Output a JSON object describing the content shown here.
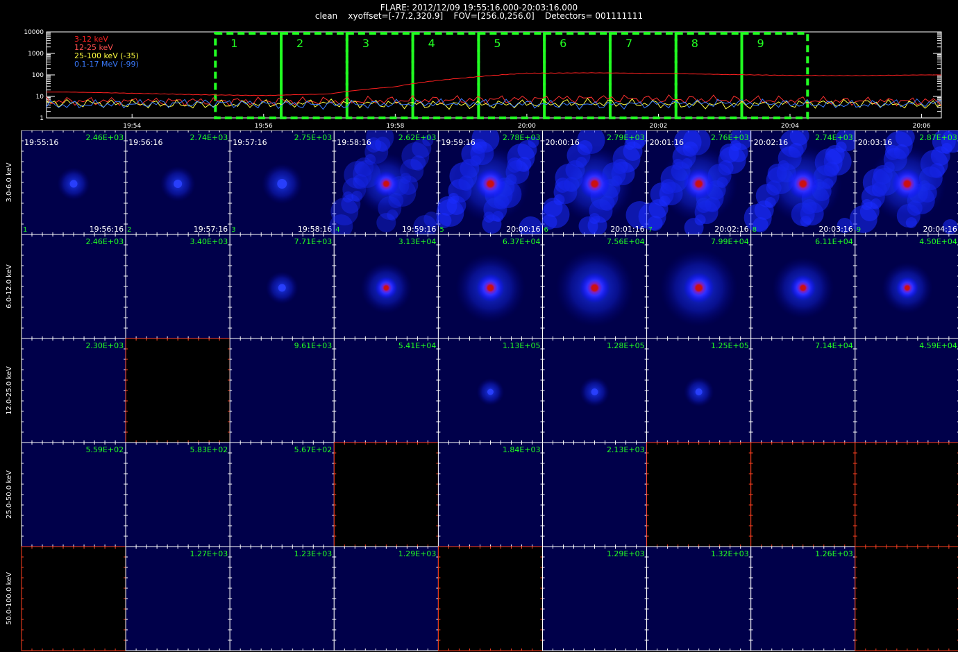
{
  "header": {
    "title": "FLARE: 2012/12/09 19:55:16.000-20:03:16.000",
    "subtitle": "clean    xyoffset=[-77.2,320.9]    FOV=[256.0,256.0]    Detectors= 001111111"
  },
  "chart_data": [
    {
      "type": "line",
      "name": "lightcurve",
      "yscale": "log",
      "ylim": [
        1,
        10000
      ],
      "y_ticks": [
        "10000",
        "1000",
        "100",
        "10",
        "1"
      ],
      "xlim_minutes": [
        19.6,
        20.12
      ],
      "x_ticks": [
        "19:54",
        "19:56",
        "19:58",
        "20:00",
        "20:02",
        "20:04",
        "20:06"
      ],
      "legend": [
        {
          "label": "3-12 keV",
          "color": "#ff2020"
        },
        {
          "label": "12-25 keV",
          "color": "#ff5050"
        },
        {
          "label": "25-100 keV (-35)",
          "color": "#ffff40"
        },
        {
          "label": "0.1-17 MeV (-99)",
          "color": "#3a7bff"
        }
      ],
      "series": [
        {
          "name": "12-25 keV",
          "color": "#ff2020",
          "x": [
            "19:53",
            "19:54",
            "19:55",
            "19:56",
            "19:57",
            "19:58",
            "19:59",
            "20:00",
            "20:01",
            "20:02",
            "20:03",
            "20:04",
            "20:05",
            "20:06"
          ],
          "values": [
            16,
            14,
            12,
            11,
            13,
            28,
            70,
            120,
            125,
            118,
            105,
            95,
            92,
            100
          ]
        },
        {
          "name": "3-12 keV",
          "color": "#ff3030",
          "x": [
            "19:53",
            "19:55",
            "19:57",
            "19:59",
            "20:01",
            "20:03",
            "20:05",
            "20:06"
          ],
          "values": [
            6,
            6,
            6,
            7,
            8,
            7,
            6,
            6
          ]
        },
        {
          "name": "25-100 keV (-35)",
          "color": "#ffff40",
          "x": [
            "19:53",
            "19:55",
            "19:57",
            "19:59",
            "20:01",
            "20:03",
            "20:05",
            "20:06"
          ],
          "values": [
            5,
            4,
            5,
            4,
            5,
            4,
            5,
            4
          ]
        },
        {
          "name": "0.1-17 MeV (-99)",
          "color": "#3a7bff",
          "x": [
            "19:53",
            "19:55",
            "19:57",
            "19:59",
            "20:01",
            "20:03",
            "20:05",
            "20:06"
          ],
          "values": [
            4,
            5,
            4,
            5,
            4,
            5,
            4,
            5
          ]
        }
      ],
      "intervals": [
        "1",
        "2",
        "3",
        "4",
        "5",
        "6",
        "7",
        "8",
        "9"
      ]
    },
    {
      "type": "heatmap",
      "name": "image-grid",
      "columns": 9,
      "start_times": [
        "19:55:16",
        "19:56:16",
        "19:57:16",
        "19:58:16",
        "19:59:16",
        "20:00:16",
        "20:01:16",
        "20:02:16",
        "20:03:16"
      ],
      "end_times": [
        "19:56:16",
        "19:57:16",
        "19:58:16",
        "19:59:16",
        "20:00:16",
        "20:01:16",
        "20:02:16",
        "20:03:16",
        "20:04:16"
      ],
      "rows": [
        {
          "label": "3.0-6.0 keV",
          "peaks": [
            "2.46E+03",
            "2.74E+03",
            "2.75E+03",
            "2.62E+03",
            "2.78E+03",
            "2.79E+03",
            "2.76E+03",
            "2.74E+03",
            "2.87E+03"
          ],
          "intensity": [
            0.15,
            0.2,
            0.3,
            0.7,
            1.0,
            1.0,
            1.0,
            1.0,
            1.0
          ]
        },
        {
          "label": "6.0-12.0 keV",
          "peaks": [
            "2.46E+03",
            "3.40E+03",
            "7.71E+03",
            "3.13E+04",
            "6.37E+04",
            "7.56E+04",
            "7.99E+04",
            "6.11E+04",
            "4.50E+04"
          ],
          "intensity": [
            0.0,
            0.0,
            0.15,
            0.5,
            0.85,
            1.0,
            1.0,
            0.7,
            0.5
          ]
        },
        {
          "label": "12.0-25.0 keV",
          "peaks": [
            "2.30E+03",
            "",
            "9.61E+03",
            "5.41E+04",
            "1.13E+05",
            "1.28E+05",
            "1.25E+05",
            "7.14E+04",
            "4.59E+04"
          ],
          "intensity": [
            0.0,
            -1,
            0.0,
            0.0,
            0.05,
            0.1,
            0.1,
            0.0,
            0.0
          ]
        },
        {
          "label": "25.0-50.0 keV",
          "peaks": [
            "5.59E+02",
            "5.83E+02",
            "5.67E+02",
            "",
            "1.84E+03",
            "2.13E+03",
            "",
            "",
            ""
          ],
          "intensity": [
            0.0,
            0.0,
            0.0,
            -1,
            0.0,
            0.0,
            -1,
            -1,
            -1
          ]
        },
        {
          "label": "50.0-100.0 keV",
          "peaks": [
            "",
            "1.27E+03",
            "1.23E+03",
            "1.29E+03",
            "",
            "1.29E+03",
            "1.32E+03",
            "1.26E+03",
            ""
          ],
          "intensity": [
            -1,
            0.0,
            0.0,
            0.0,
            -1,
            0.0,
            0.0,
            0.0,
            -1
          ]
        }
      ]
    }
  ]
}
